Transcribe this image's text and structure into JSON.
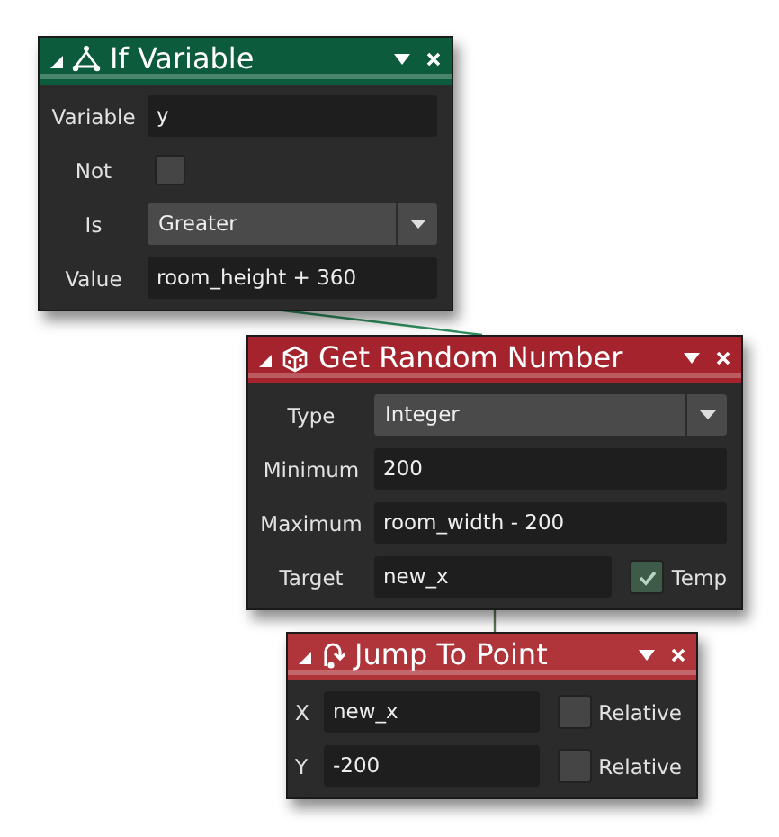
{
  "blocks": [
    {
      "title": "If Variable",
      "color": "#0c5b3d",
      "rows": [
        {
          "kind": "field",
          "label": "Variable",
          "value": "y"
        },
        {
          "kind": "checkbox",
          "label": "Not",
          "checked": false
        },
        {
          "kind": "dropdown",
          "label": "Is",
          "value": "Greater"
        },
        {
          "kind": "field",
          "label": "Value",
          "value": "room_height + 360"
        }
      ]
    },
    {
      "title": "Get Random Number",
      "color": "#a5232c",
      "rows": [
        {
          "kind": "dropdown",
          "label": "Type",
          "value": "Integer"
        },
        {
          "kind": "field",
          "label": "Minimum",
          "value": "200"
        },
        {
          "kind": "field",
          "label": "Maximum",
          "value": "room_width - 200"
        },
        {
          "kind": "field",
          "label": "Target",
          "value": "new_x",
          "option": {
            "label": "Temp",
            "checked": true
          }
        }
      ]
    },
    {
      "title": "Jump To Point",
      "color": "#b0353b",
      "rows": [
        {
          "kind": "field",
          "label": "X",
          "value": "new_x",
          "option": {
            "label": "Relative",
            "checked": false
          }
        },
        {
          "kind": "field",
          "label": "Y",
          "value": "-200",
          "option": {
            "label": "Relative",
            "checked": false
          }
        }
      ]
    }
  ]
}
